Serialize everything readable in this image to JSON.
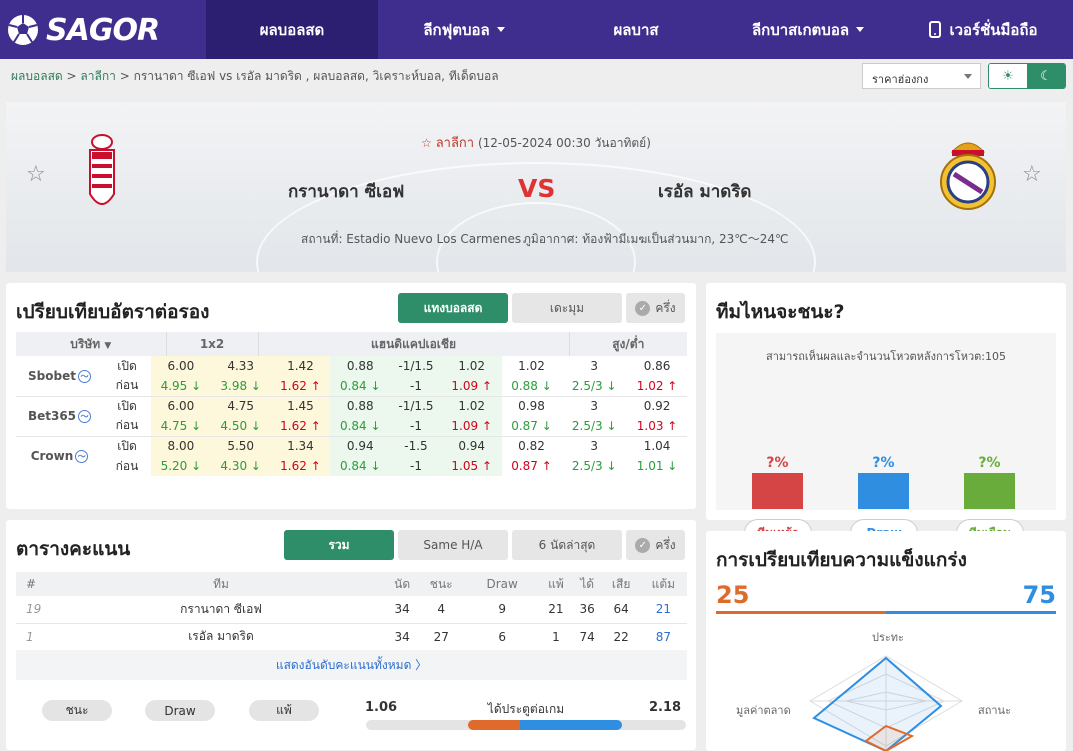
{
  "brand": {
    "name": "SAGOR",
    "accent": "#3f2e8e",
    "green": "#2e8e6a"
  },
  "nav": {
    "items": [
      "ผลบอลสด",
      "ลีกฟุตบอล",
      "ผลบาส",
      "ลีกบาสเกตบอล",
      "เวอร์ชั่นมือถือ"
    ]
  },
  "breadcrumb": {
    "home": "ผลบอลสด",
    "league": "ลาลีกา",
    "rest": "กรานาดา ซีเอฟ vs  เรอัล มาดริด ,  ผลบอลสด,  วิเคราะห์บอล,  ทีเด็ดบอล",
    "sep": ">"
  },
  "toolbar": {
    "odds_select": "ราคาฮ่องกง",
    "sun_icon": "☀",
    "moon_icon": "☾"
  },
  "match": {
    "league": "ลาลีกา",
    "datetime": "(12-05-2024 00:30 วันอาทิตย์)",
    "home": "กรานาดา ซีเอฟ",
    "away": "เรอัล มาดริด",
    "vs": "VS",
    "venue": "สถานที่: Estadio Nuevo Los Carmenes",
    "weather": "ภูมิอากาศ: ท้องฟ้ามีเมฆเป็นส่วนมาก, 23℃～24℃"
  },
  "odds": {
    "title": "เปรียบเทียบอัตราต่อรอง",
    "tabs": [
      "แทงบอลสด",
      "เดะมุม",
      "ครึ่ง"
    ],
    "headers": [
      "บริษัท",
      "1x2",
      "แฮนดิแคปเอเชีย",
      "สูง/ต่ำ"
    ],
    "rows": [
      {
        "book": "Sbobet",
        "open": [
          "เปิด",
          "6.00",
          "4.33",
          "1.42",
          "0.88",
          "-1/1.5",
          "1.02",
          "1.02",
          "3",
          "0.86"
        ],
        "close": [
          "ก่อน",
          "4.95 ↓",
          "3.98 ↓",
          "1.62 ↑",
          "0.84 ↓",
          "-1",
          "1.09 ↑",
          "0.88 ↓",
          "2.5/3 ↓",
          "1.02 ↑"
        ]
      },
      {
        "book": "Bet365",
        "open": [
          "เปิด",
          "6.00",
          "4.75",
          "1.45",
          "0.88",
          "-1/1.5",
          "1.02",
          "0.98",
          "3",
          "0.92"
        ],
        "close": [
          "ก่อน",
          "4.75 ↓",
          "4.50 ↓",
          "1.62 ↑",
          "0.84 ↓",
          "-1",
          "1.09 ↑",
          "0.87 ↓",
          "2.5/3 ↓",
          "1.03 ↑"
        ]
      },
      {
        "book": "Crown",
        "open": [
          "เปิด",
          "8.00",
          "5.50",
          "1.34",
          "0.94",
          "-1.5",
          "0.94",
          "0.82",
          "3",
          "1.04"
        ],
        "close": [
          "ก่อน",
          "5.20 ↓",
          "4.30 ↓",
          "1.62 ↑",
          "0.84 ↓",
          "-1",
          "1.05 ↑",
          "0.87 ↑",
          "2.5/3 ↓",
          "1.01 ↓"
        ]
      }
    ]
  },
  "standings": {
    "title": "ตารางคะแนน",
    "tabs": [
      "รวม",
      "Same H/A",
      "6 นัดล่าสุด",
      "ครึ่ง"
    ],
    "headers": [
      "#",
      "ทีม",
      "นัด",
      "ชนะ",
      "Draw",
      "แพ้",
      "ได้",
      "เสีย",
      "แต้ม"
    ],
    "rows": [
      [
        "19",
        "กรานาดา ซีเอฟ",
        "34",
        "4",
        "9",
        "21",
        "36",
        "64",
        "21"
      ],
      [
        "1",
        "เรอัล มาดริด",
        "34",
        "27",
        "6",
        "1",
        "74",
        "22",
        "87"
      ]
    ],
    "more": "แสดงอันดับคะแนนทั้งหมด 〉",
    "result_pills": [
      "ชนะ",
      "Draw",
      "แพ้"
    ],
    "goals_label": "ได้ประตูต่อเกม",
    "goals_home": "1.06",
    "goals_away": "2.18"
  },
  "predict": {
    "title": "ทีมไหนจะชนะ?",
    "subtitle": "สามารถเห็นผลและจำนวนโหวตหลังการโหวต:105",
    "pcts": [
      "?%",
      "?%",
      "?%"
    ],
    "votes": [
      "ทีมเหย้า",
      "Draw",
      "ทีมเยือน"
    ],
    "colors": [
      "#d64545",
      "#2f8ee0",
      "#6aac3c"
    ]
  },
  "strength": {
    "title": "การเปรียบเทียบความแข็งแกร่ง",
    "home": "25",
    "away": "75",
    "axes": [
      "ประทะ",
      "สถานะ",
      "มูลค่าตลาด"
    ]
  }
}
